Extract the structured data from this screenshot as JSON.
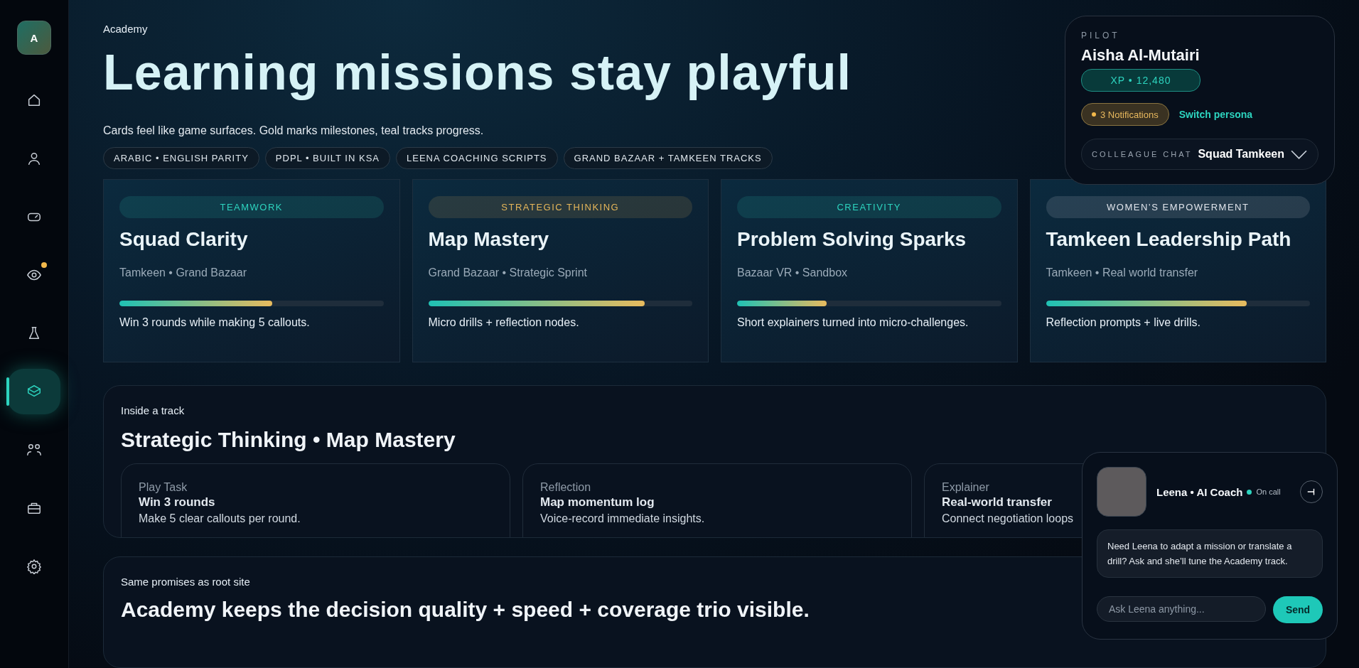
{
  "sidebar": {
    "avatar": "A",
    "items": [
      {
        "kind": "home",
        "selected": false,
        "badge": false
      },
      {
        "kind": "user",
        "selected": false,
        "badge": false
      },
      {
        "kind": "gamepad",
        "selected": false,
        "badge": false
      },
      {
        "kind": "eye",
        "selected": false,
        "badge": true
      },
      {
        "kind": "flask",
        "selected": false,
        "badge": false
      },
      {
        "kind": "layers",
        "selected": true,
        "badge": false
      },
      {
        "kind": "users",
        "selected": false,
        "badge": false
      },
      {
        "kind": "briefcase",
        "selected": false,
        "badge": false
      },
      {
        "kind": "settings",
        "selected": false,
        "badge": false
      }
    ]
  },
  "header": {
    "eyebrow": "Academy",
    "title": "Learning missions stay playful",
    "subtitle": "Cards feel like game surfaces. Gold marks milestones, teal tracks progress.",
    "chips": [
      "ARABIC • ENGLISH PARITY",
      "PDPL • BUILT IN KSA",
      "LEENA COACHING SCRIPTS",
      "GRAND BAZAAR + TAMKEEN TRACKS"
    ]
  },
  "pilot": {
    "label": "PILOT",
    "name": "Aisha Al-Mutairi",
    "xp": "XP • 12,480",
    "notifications": "3 Notifications",
    "switch_link": "Switch persona",
    "chat_label": "COLLEAGUE CHAT",
    "chat_value": "Squad Tamkeen"
  },
  "missions": [
    {
      "tag": "TEAMWORK",
      "color": "#2dd4bf",
      "title": "Squad Clarity",
      "meta": "Tamkeen • Grand Bazaar",
      "level": 0.58,
      "note": "Win 3 rounds while making 5 callouts."
    },
    {
      "tag": "STRATEGIC THINKING",
      "color": "#e5b65a",
      "title": "Map Mastery",
      "meta": "Grand Bazaar • Strategic Sprint",
      "level": 0.82,
      "note": "Micro drills + reflection nodes."
    },
    {
      "tag": "CREATIVITY",
      "color": "#2dd4bf",
      "title": "Problem Solving Sparks",
      "meta": "Bazaar VR • Sandbox",
      "level": 0.34,
      "note": "Short explainers turned into micro-challenges."
    },
    {
      "tag": "WOMEN’S EMPOWERMENT",
      "color": "#dfe3ea",
      "title": "Tamkeen Leadership Path",
      "meta": "Tamkeen • Real world transfer",
      "level": 0.76,
      "note": "Reflection prompts + live drills."
    }
  ],
  "track": {
    "eyebrow": "Inside a track",
    "title": "Strategic Thinking • Map Mastery",
    "steps": [
      {
        "label": "Play Task",
        "title": "Win 3 rounds",
        "text": "Make 5 clear callouts per round."
      },
      {
        "label": "Reflection",
        "title": "Map momentum log",
        "text": "Voice-record immediate insights."
      },
      {
        "label": "Explainer",
        "title": "Real-world transfer",
        "text": "Connect negotiation loops"
      }
    ]
  },
  "promises": {
    "eyebrow": "Same promises as root site",
    "title": "Academy keeps the decision quality + speed + coverage trio visible."
  },
  "coach": {
    "name": "Leena • AI Coach",
    "status": "On call",
    "online": true,
    "message": "Need Leena to adapt a mission or translate a drill? Ask and she’ll tune the Academy track.",
    "placeholder": "Ask Leena anything...",
    "send": "Send"
  }
}
